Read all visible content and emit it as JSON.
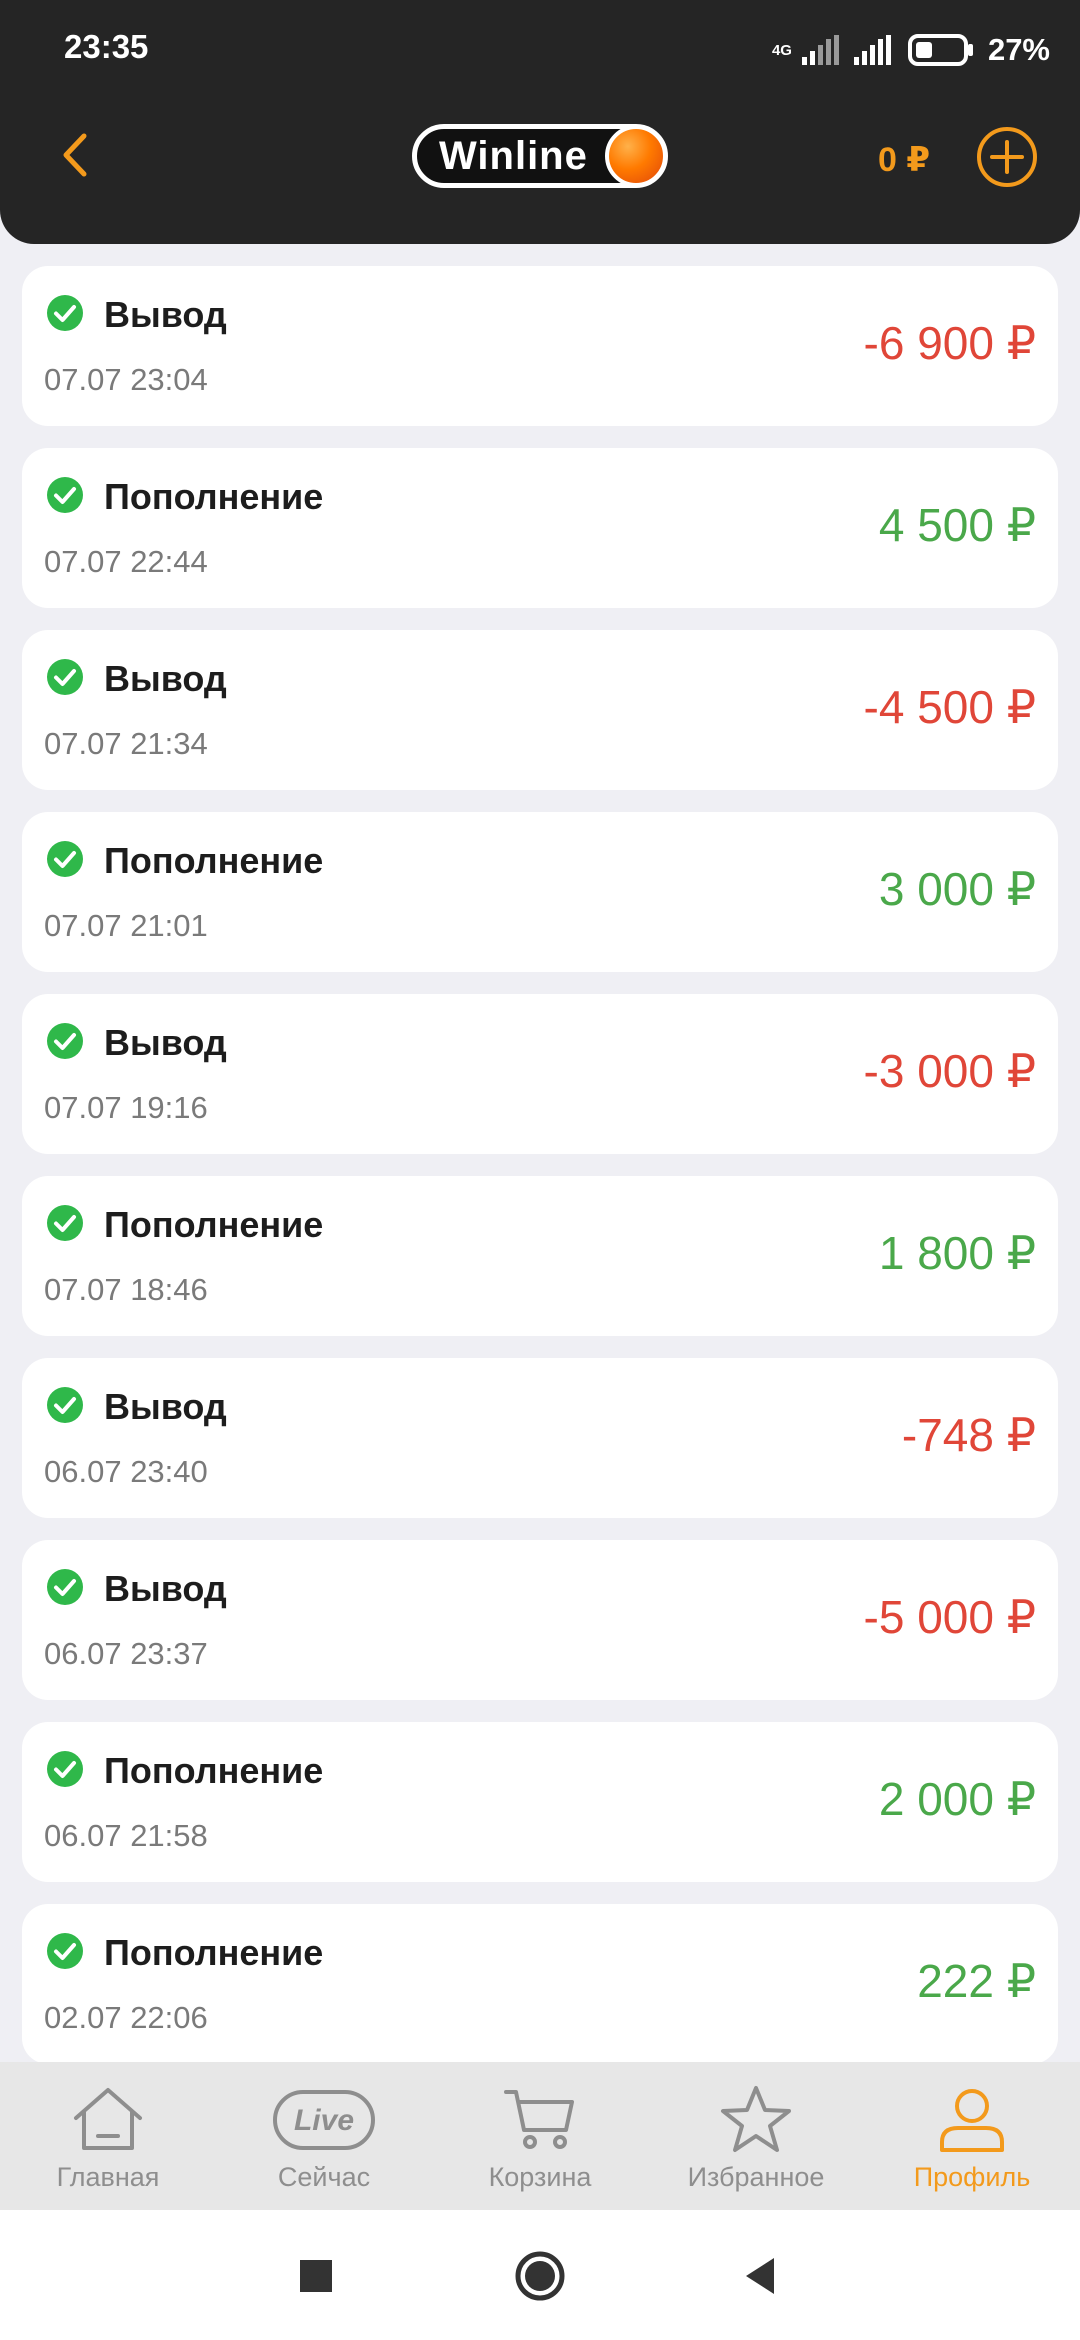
{
  "status_bar": {
    "time": "23:35",
    "network": "4G",
    "battery": "27%"
  },
  "header": {
    "logo": "Winline",
    "balance": "0 ₽"
  },
  "transactions": [
    {
      "title": "Вывод",
      "datetime": "07.07 23:04",
      "amount": "-6 900 ₽",
      "type": "withdraw"
    },
    {
      "title": "Пополнение",
      "datetime": "07.07 22:44",
      "amount": "4 500 ₽",
      "type": "deposit"
    },
    {
      "title": "Вывод",
      "datetime": "07.07 21:34",
      "amount": "-4 500 ₽",
      "type": "withdraw"
    },
    {
      "title": "Пополнение",
      "datetime": "07.07 21:01",
      "amount": "3 000 ₽",
      "type": "deposit"
    },
    {
      "title": "Вывод",
      "datetime": "07.07 19:16",
      "amount": "-3 000 ₽",
      "type": "withdraw"
    },
    {
      "title": "Пополнение",
      "datetime": "07.07 18:46",
      "amount": "1 800 ₽",
      "type": "deposit"
    },
    {
      "title": "Вывод",
      "datetime": "06.07 23:40",
      "amount": "-748 ₽",
      "type": "withdraw"
    },
    {
      "title": "Вывод",
      "datetime": "06.07 23:37",
      "amount": "-5 000 ₽",
      "type": "withdraw"
    },
    {
      "title": "Пополнение",
      "datetime": "06.07 21:58",
      "amount": "2 000 ₽",
      "type": "deposit"
    },
    {
      "title": "Пополнение",
      "datetime": "02.07 22:06",
      "amount": "222 ₽",
      "type": "deposit"
    }
  ],
  "bottom_nav": [
    {
      "label": "Главная",
      "icon": "home-icon",
      "active": false
    },
    {
      "label": "Сейчас",
      "icon": "live-icon",
      "icon_text": "Live",
      "active": false
    },
    {
      "label": "Корзина",
      "icon": "cart-icon",
      "active": false
    },
    {
      "label": "Избранное",
      "icon": "star-icon",
      "active": false
    },
    {
      "label": "Профиль",
      "icon": "profile-icon",
      "active": true
    }
  ],
  "colors": {
    "accent": "#f39a1c",
    "header_bg": "#252525",
    "negative": "#e04638",
    "positive": "#4aa84a",
    "check": "#2fb84a"
  }
}
